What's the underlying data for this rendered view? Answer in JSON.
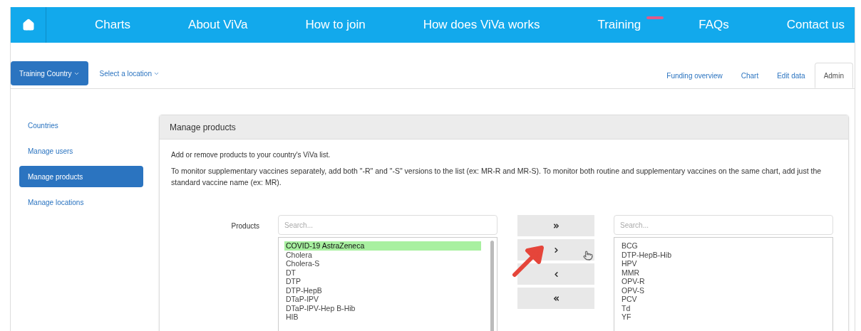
{
  "nav": {
    "items": [
      {
        "label": "Charts"
      },
      {
        "label": "About ViVa"
      },
      {
        "label": "How to join"
      },
      {
        "label": "How does ViVa works"
      },
      {
        "label": "Training",
        "badge": true
      },
      {
        "label": "FAQs"
      },
      {
        "label": "Contact us"
      }
    ]
  },
  "toolbar": {
    "country": "Training Country",
    "location": "Select a location"
  },
  "tabs": [
    {
      "label": "Funding overview",
      "selected": false
    },
    {
      "label": "Chart",
      "selected": false
    },
    {
      "label": "Edit data",
      "selected": false
    },
    {
      "label": "Admin",
      "selected": true
    }
  ],
  "sidebar": {
    "items": [
      {
        "label": "Countries",
        "selected": false
      },
      {
        "label": "Manage users",
        "selected": false
      },
      {
        "label": "Manage products",
        "selected": true
      },
      {
        "label": "Manage locations",
        "selected": false
      }
    ]
  },
  "panel": {
    "title": "Manage products",
    "intro": "Add or remove products to your country's ViVa list.",
    "note": "To monitor supplementary vaccines separately, add both \"-R\" and \"-S\" versions to the list (ex: MR-R and MR-S). To monitor both routine and supplementary vaccines on the same chart, add just the standard vaccine name (ex: MR).",
    "products_label": "Products",
    "available": {
      "placeholder": "Search...",
      "items": [
        {
          "label": "COVID-19 AstraZeneca",
          "selected": true
        },
        {
          "label": "Cholera",
          "selected": false
        },
        {
          "label": "Cholera-S",
          "selected": false
        },
        {
          "label": "DT",
          "selected": false
        },
        {
          "label": "DTP",
          "selected": false
        },
        {
          "label": "DTP-HepB",
          "selected": false
        },
        {
          "label": "DTaP-IPV",
          "selected": false
        },
        {
          "label": "DTaP-IPV-Hep B-Hib",
          "selected": false
        },
        {
          "label": "HIB",
          "selected": false
        }
      ]
    },
    "buttons": [
      {
        "kind": "add-all"
      },
      {
        "kind": "add"
      },
      {
        "kind": "remove"
      },
      {
        "kind": "remove-all"
      }
    ],
    "chosen": {
      "placeholder": "Search...",
      "items": [
        {
          "label": "BCG",
          "selected": false
        },
        {
          "label": "DTP-HepB-Hib",
          "selected": false
        },
        {
          "label": "HPV",
          "selected": false
        },
        {
          "label": "MMR",
          "selected": false
        },
        {
          "label": "OPV-R",
          "selected": false
        },
        {
          "label": "OPV-S",
          "selected": false
        },
        {
          "label": "PCV",
          "selected": false
        },
        {
          "label": "Td",
          "selected": false
        },
        {
          "label": "YF",
          "selected": false
        }
      ]
    }
  }
}
